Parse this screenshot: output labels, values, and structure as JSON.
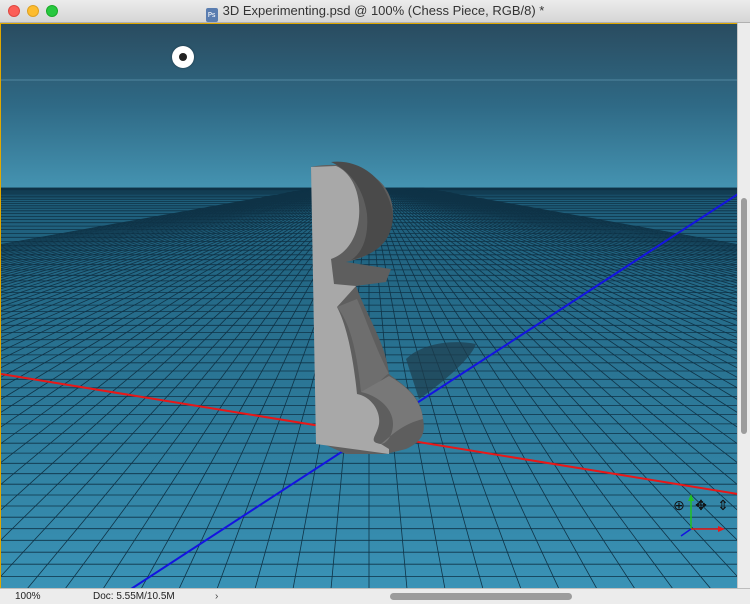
{
  "window": {
    "title": "3D Experimenting.psd @ 100% (Chess Piece, RGB/8) *",
    "doc_icon": "psd-file-icon"
  },
  "canvas": {
    "scene": "3d-ground-plane-with-chess-piece",
    "colors": {
      "sky_top": "#2a4c60",
      "sky_bottom": "#3f8fad",
      "grid_bg": "#2f7a99",
      "grid_line": "#0f3347",
      "x_axis": "#e81818",
      "z_axis": "#1414e0",
      "piece_light": "#a8a8a8",
      "piece_dark": "#5e5e5e"
    },
    "icons": [
      "light-bulb-icon",
      "orbit-3d-camera-icon",
      "pan-3d-camera-icon",
      "dolly-3d-camera-icon",
      "axis-widget-icon"
    ]
  },
  "status": {
    "zoom": "100%",
    "doc": "Doc: 5.55M/10.5M",
    "arrow": "›"
  }
}
